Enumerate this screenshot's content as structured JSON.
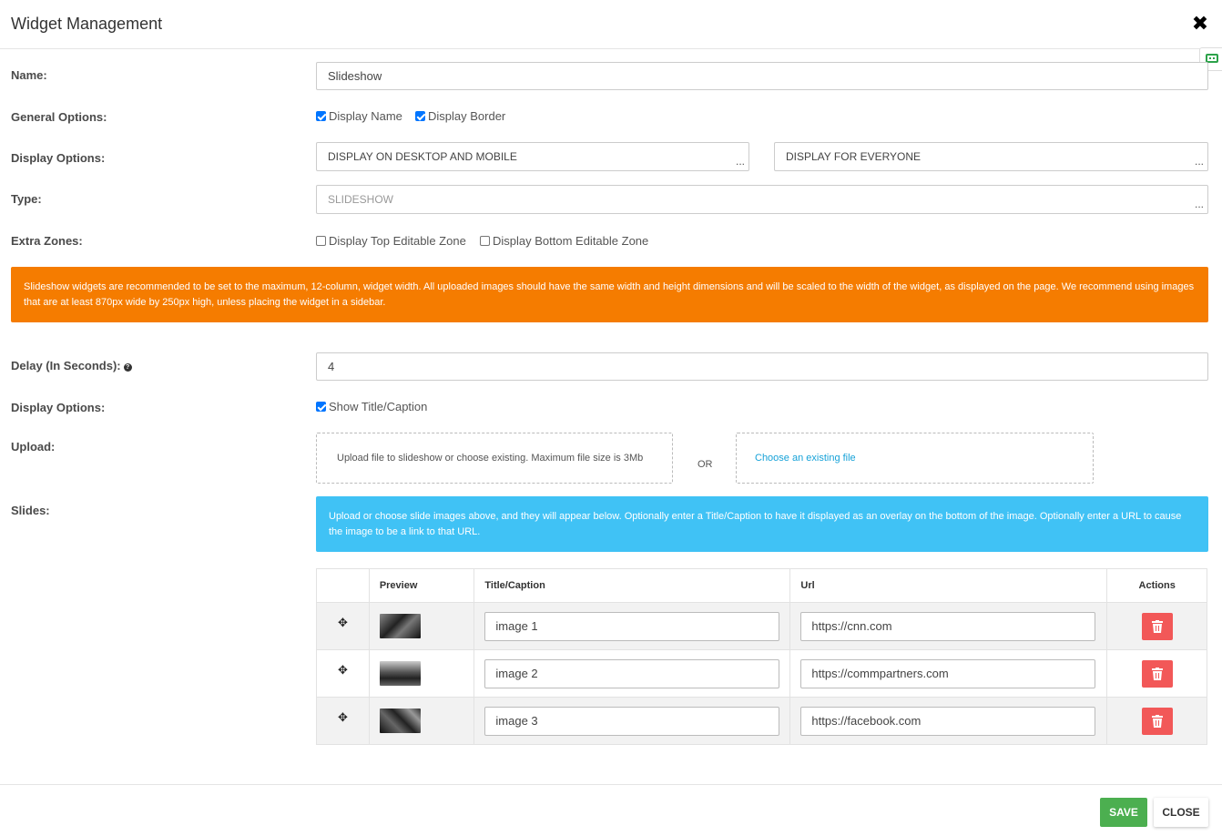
{
  "header": {
    "title": "Widget Management"
  },
  "fields": {
    "name_label": "Name:",
    "name_value": "Slideshow",
    "general_label": "General Options:",
    "display_name": "Display Name",
    "display_border": "Display Border",
    "display_options_label": "Display Options:",
    "device_option": "DISPLAY ON DESKTOP AND MOBILE",
    "audience_option": "DISPLAY FOR EVERYONE",
    "dots": "...",
    "type_label": "Type:",
    "type_value": "SLIDESHOW",
    "extra_label": "Extra Zones:",
    "top_zone": "Display Top Editable Zone",
    "bottom_zone": "Display Bottom Editable Zone",
    "delay_label": "Delay (In Seconds):",
    "delay_value": "4",
    "display_options2_label": "Display Options:",
    "show_caption": "Show Title/Caption",
    "upload_label": "Upload:",
    "upload_text": "Upload file to slideshow or choose existing. Maximum file size is 3Mb",
    "or_text": "OR",
    "choose_existing": "Choose an existing file",
    "slides_label": "Slides:"
  },
  "alerts": {
    "warning": "Slideshow widgets are recommended to be set to the maximum, 12-column, widget width. All uploaded images should have the same width and height dimensions and will be scaled to the width of the widget, as displayed on the page. We recommend using images that are at least 870px wide by 250px high, unless placing the widget in a sidebar.",
    "info": "Upload or choose slide images above, and they will appear below. Optionally enter a Title/Caption to have it displayed as an overlay on the bottom of the image. Optionally enter a URL to cause the image to be a link to that URL."
  },
  "table": {
    "headers": {
      "preview": "Preview",
      "title": "Title/Caption",
      "url": "Url",
      "actions": "Actions"
    },
    "rows": [
      {
        "title": "image 1",
        "url": "https://cnn.com"
      },
      {
        "title": "image 2",
        "url": "https://commpartners.com"
      },
      {
        "title": "image 3",
        "url": "https://facebook.com"
      }
    ]
  },
  "footer": {
    "save": "SAVE",
    "close": "CLOSE"
  },
  "colors": {
    "warning": "#f57c00",
    "info": "#40c2f5",
    "save": "#4caf50",
    "delete": "#f25858"
  }
}
